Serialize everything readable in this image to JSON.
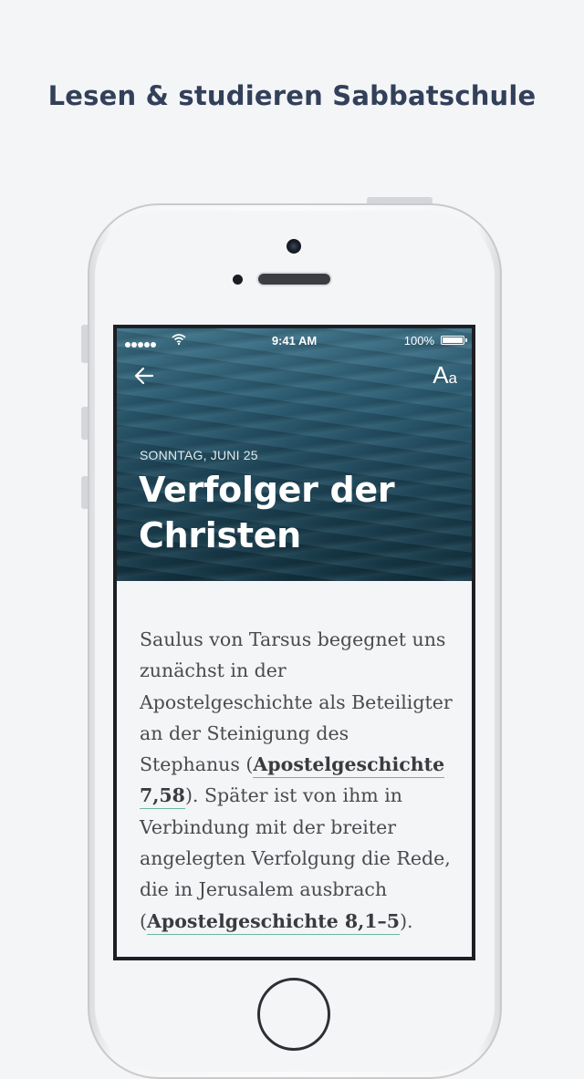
{
  "promo": {
    "title": "Lesen & studieren Sabbatschule"
  },
  "status_bar": {
    "time": "9:41 AM",
    "battery": "100%"
  },
  "nav": {
    "font_button_big": "A",
    "font_button_small": "a"
  },
  "lesson": {
    "date": "SONNTAG, JUNI 25",
    "title_line1": "Verfolger der",
    "title_line2": "Christen"
  },
  "content": {
    "text_1": "Saulus von Tarsus begegnet uns zunächst in der Apostelgeschichte als Beteiligter an der Steinigung des Stephanus (",
    "ref_1": "Apostelgeschichte 7,58",
    "text_2": "). Später ist von ihm in Verbindung mit der breiter angelegten Verfolgung die Rede, die in Jerusalem ausbrach (",
    "ref_2": "Apostelgeschichte 8,1–5",
    "text_3": ")."
  },
  "colors": {
    "accent_underline": "#68b8a2",
    "promo_title": "#33405a"
  },
  "icons": [
    "back-arrow-icon",
    "wifi-icon",
    "battery-icon",
    "signal-icon"
  ]
}
